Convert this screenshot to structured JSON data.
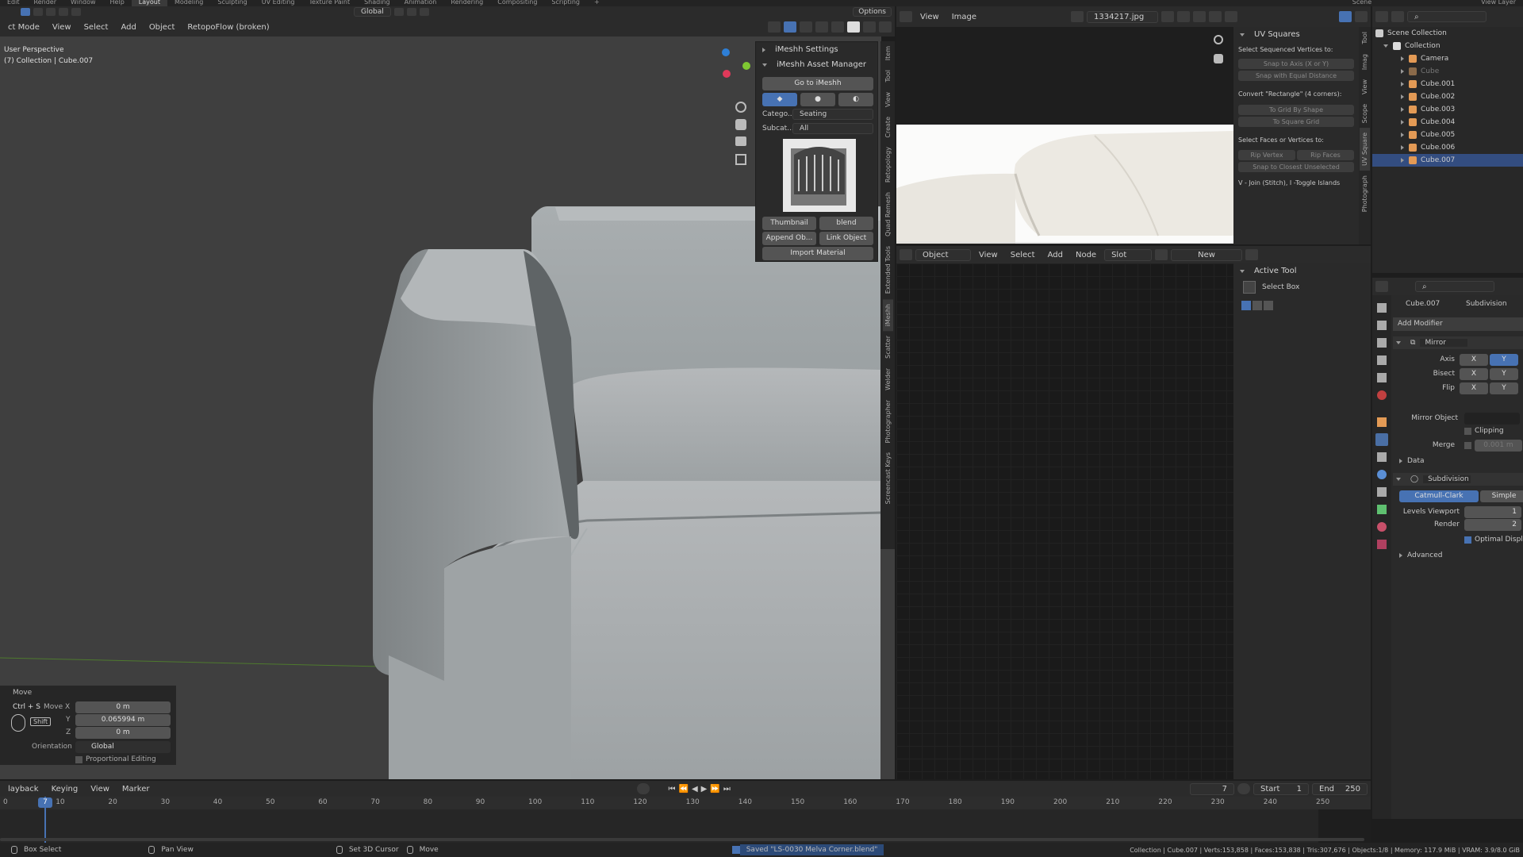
{
  "topbar": {
    "menus": [
      "Edit",
      "Render",
      "Window",
      "Help"
    ],
    "workspaces": [
      "Layout",
      "Modeling",
      "Sculpting",
      "UV Editing",
      "Texture Paint",
      "Shading",
      "Animation",
      "Rendering",
      "Compositing",
      "Scripting",
      "+"
    ],
    "active_workspace": "Layout",
    "scene_label": "Scene",
    "view_layer_label": "View Layer"
  },
  "viewport": {
    "mode": "ct Mode",
    "menus": [
      "View",
      "Select",
      "Add",
      "Object"
    ],
    "retopo": "RetopoFlow (broken)",
    "transform": "Global",
    "options": "Options",
    "info_line1": "User Perspective",
    "info_line2": "(7) Collection | Cube.007"
  },
  "npanel": {
    "imeshh_settings": "iMeshh Settings",
    "asset_manager": "iMeshh Asset Manager",
    "go_to_imeshh": "Go to iMeshh",
    "category_label": "Catego...",
    "category_value": "Seating",
    "subcategory_label": "Subcat...",
    "subcategory_value": "All",
    "thumbnail_btn": "Thumbnail",
    "blend_btn": "blend",
    "append_btn": "Append Ob...",
    "link_btn": "Link Object",
    "import_material_btn": "Import Material",
    "side_tabs": [
      "Item",
      "Tool",
      "View",
      "Create",
      "Retopology",
      "Quad Remesh",
      "Extended Tools",
      "iMeshh",
      "Scatter",
      "Welder",
      "Photographer",
      "Screencast Keys"
    ]
  },
  "operator_panel": {
    "title": "Move",
    "shortcut": "Ctrl + S",
    "shift_label": "Shift",
    "move_x_label": "Move X",
    "move_x": "0 m",
    "y_label": "Y",
    "move_y": "0.065994 m",
    "z_label": "Z",
    "move_z": "0 m",
    "orientation_label": "Orientation",
    "orientation_value": "Global",
    "proportional": "Proportional Editing"
  },
  "image_editor": {
    "menus": [
      "View",
      "Image"
    ],
    "image_name": "1334217.jpg"
  },
  "uv_squares": {
    "title": "UV Squares",
    "select_seq": "Select Sequenced Vertices to:",
    "snap_axis": "Snap to Axis (X or Y)",
    "snap_equal": "Snap with Equal Distance",
    "convert_rect": "Convert \"Rectangle\" (4 corners):",
    "to_grid_shape": "To Grid By Shape",
    "to_square_grid": "To Square Grid",
    "select_faces": "Select Faces or Vertices to:",
    "rip_vertex": "Rip Vertex",
    "rip_faces": "Rip Faces",
    "snap_closest": "Snap to Closest Unselected",
    "join_hint": "V - Join (Stitch), I -Toggle Islands",
    "side_tabs": [
      "Tool",
      "Imag",
      "View",
      "Scope",
      "UV Square",
      "Photograph"
    ]
  },
  "node_editor": {
    "object_label": "Object",
    "menus": [
      "View",
      "Select",
      "Add",
      "Node"
    ],
    "slot": "Slot",
    "new_btn": "New"
  },
  "active_tool": {
    "title": "Active Tool",
    "tool": "Select Box"
  },
  "outliner": {
    "scene_collection": "Scene Collection",
    "collection": "Collection",
    "items": [
      "Camera",
      "Cube",
      "Cube.001",
      "Cube.002",
      "Cube.003",
      "Cube.004",
      "Cube.005",
      "Cube.006",
      "Cube.007"
    ],
    "selected": "Cube.007"
  },
  "properties": {
    "object_name": "Cube.007",
    "modifier_name": "Subdivision",
    "add_modifier": "Add Modifier",
    "mirror": "Mirror",
    "axis_label": "Axis",
    "bisect_label": "Bisect",
    "flip_label": "Flip",
    "x": "X",
    "y": "Y",
    "mirror_object": "Mirror Object",
    "clipping": "Clipping",
    "merge_label": "Merge",
    "merge_value": "0.001 m",
    "data_label": "Data",
    "subdivision": "Subdivision",
    "catmull": "Catmull-Clark",
    "simple": "Simple",
    "levels_viewport_label": "Levels Viewport",
    "levels_viewport": "1",
    "render_label": "Render",
    "render_value": "2",
    "optimal_display": "Optimal Display",
    "advanced": "Advanced"
  },
  "timeline": {
    "menus": [
      "layback",
      "Keying",
      "View",
      "Marker"
    ],
    "current_frame": "7",
    "start_label": "Start",
    "start": "1",
    "end_label": "End",
    "end": "250",
    "ticks": [
      "0",
      "10",
      "20",
      "30",
      "40",
      "50",
      "60",
      "70",
      "80",
      "90",
      "100",
      "110",
      "120",
      "130",
      "140",
      "150",
      "160",
      "170",
      "180",
      "190",
      "200",
      "210",
      "220",
      "230",
      "240",
      "250"
    ]
  },
  "status": {
    "box_select": "Box Select",
    "pan_view": "Pan View",
    "set_cursor": "Set 3D Cursor",
    "move": "Move",
    "saved_msg": "Saved \"LS-0030 Melva Corner.blend\"",
    "stats": "Collection | Cube.007 | Verts:153,858 | Faces:153,838 | Tris:307,676 | Objects:1/8 | Memory: 117.9 MiB | VRAM: 3.9/8.0 GiB"
  },
  "colors": {
    "accent": "#4772b3",
    "selected_row": "#334d80",
    "viewport_bg": "#3f3f3f"
  }
}
